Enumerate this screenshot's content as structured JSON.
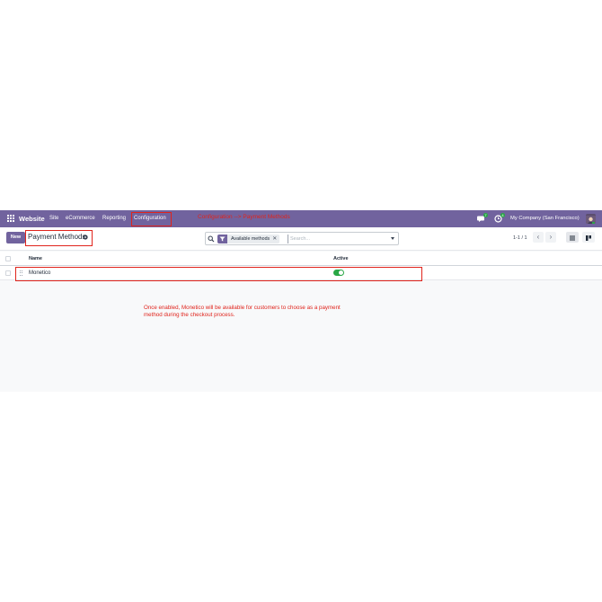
{
  "navbar": {
    "brand": "Website",
    "menu": [
      "Site",
      "eCommerce",
      "Reporting",
      "Configuration"
    ],
    "annotation": "Configuration --> Payment Methods",
    "messages_badge": "7",
    "activity_badge": "4",
    "company": "My Company (San Francisco)"
  },
  "control_panel": {
    "new_label": "New",
    "title": "Payment Methods",
    "search": {
      "facet_label": "Available methods",
      "facet_close": "✕",
      "placeholder": "Search..."
    },
    "pager": "1-1 / 1"
  },
  "list": {
    "columns": [
      "Name",
      "Active"
    ],
    "rows": [
      {
        "name": "Monetico",
        "active": true
      }
    ]
  },
  "note": "Once enabled, Monetico will be available for customers to choose as a payment method during the checkout process.",
  "colors": {
    "brand": "#71639e",
    "annotation": "#e0241c",
    "toggle_on": "#28a745"
  }
}
